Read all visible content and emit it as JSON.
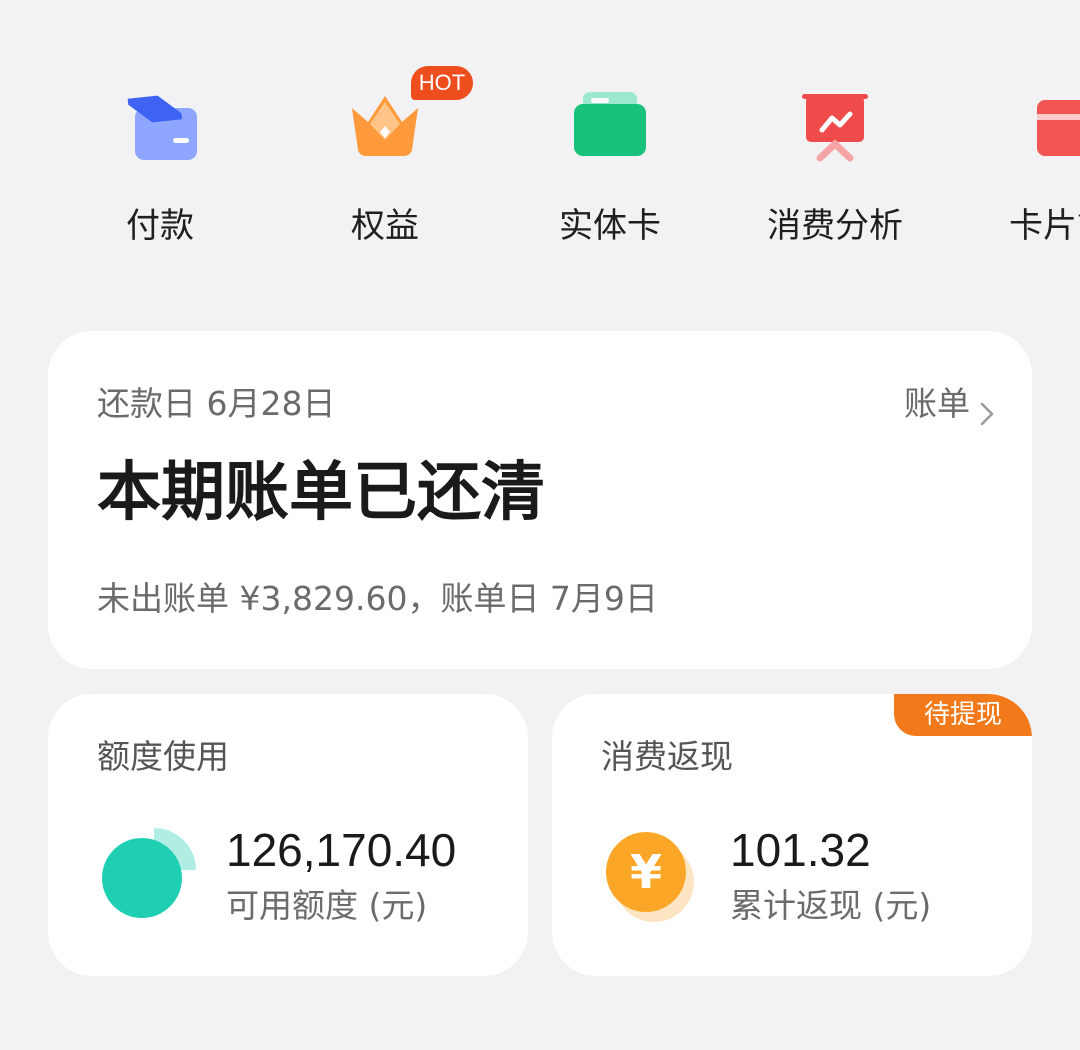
{
  "shortcuts": [
    {
      "label": "付款",
      "icon": "payment-card-icon",
      "color": "#5b7cfa"
    },
    {
      "label": "权益",
      "icon": "crown-benefits-icon",
      "color": "#ff8a2b",
      "badge": "HOT"
    },
    {
      "label": "实体卡",
      "icon": "physical-card-icon",
      "color": "#19c27a"
    },
    {
      "label": "消费分析",
      "icon": "spending-analysis-icon",
      "color": "#ef4b4b"
    },
    {
      "label": "卡片管",
      "icon": "card-management-icon",
      "color": "#f35454"
    }
  ],
  "bill": {
    "repayment_date": "还款日 6月28日",
    "link_label": "账单",
    "status": "本期账单已还清",
    "unbilled": "未出账单 ¥3,829.60，账单日 7月9日"
  },
  "quota": {
    "title": "额度使用",
    "value": "126,170.40",
    "label": "可用额度 (元)",
    "available_fraction": 0.75,
    "color": "#1ecfb2"
  },
  "cashback": {
    "title": "消费返现",
    "badge": "待提现",
    "value": "101.32",
    "label": "累计返现 (元)",
    "icon": "yuan-coin-icon",
    "color": "#fca628"
  },
  "colors": {
    "background": "#f2f2f5",
    "card": "#ffffff",
    "hot_badge": "#ee4d1d",
    "pending_badge": "#f27a1a"
  }
}
